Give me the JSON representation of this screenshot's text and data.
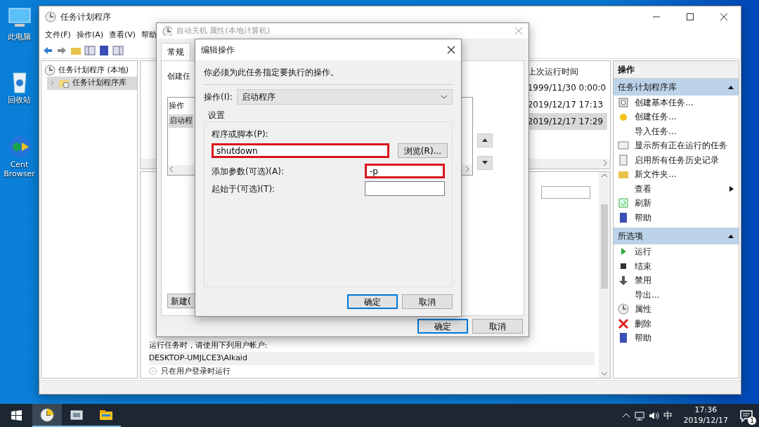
{
  "desktop_icons": [
    {
      "label": "此电脑"
    },
    {
      "label": "回收站"
    },
    {
      "label": "Cent Browser"
    }
  ],
  "main_window": {
    "title": "任务计划程序",
    "menu": [
      "文件(F)",
      "操作(A)",
      "查看(V)",
      "帮助"
    ],
    "tree": [
      {
        "label": "任务计划程序 (本地)",
        "selected": false,
        "children": [
          {
            "label": "任务计划程序库",
            "selected": true,
            "expanded": false
          }
        ]
      }
    ],
    "task_list": {
      "column": "上次运行时间",
      "rows": [
        {
          "cell": "1999/11/30 0:00:0",
          "selected": false
        },
        {
          "cell": "2019/12/17 17:13",
          "selected": false
        },
        {
          "cell": "2019/12/17 17:29",
          "selected": true
        }
      ]
    },
    "details": {
      "account_label": "运行任务时，请使用下列用户帐户:",
      "account": "DESKTOP-UMJLCE3\\Alkaid",
      "radio": {
        "label": "只在用户登录时运行",
        "checked": false
      }
    },
    "actions_pane": {
      "title": "操作",
      "sections": [
        {
          "title": "任务计划程序库",
          "items": [
            {
              "label": "创建基本任务...",
              "submenu": false
            },
            {
              "label": "创建任务...",
              "submenu": false
            },
            {
              "label": "导入任务...",
              "submenu": false
            },
            {
              "label": "显示所有正在运行的任务",
              "submenu": false
            },
            {
              "label": "启用所有任务历史记录",
              "submenu": false
            },
            {
              "label": "新文件夹...",
              "submenu": false
            },
            {
              "label": "查看",
              "submenu": true
            },
            {
              "label": "刷新",
              "submenu": false
            },
            {
              "label": "帮助",
              "submenu": false
            }
          ]
        },
        {
          "title": "所选项",
          "items": [
            {
              "label": "运行",
              "submenu": false
            },
            {
              "label": "结束",
              "submenu": false
            },
            {
              "label": "禁用",
              "submenu": false
            },
            {
              "label": "导出...",
              "submenu": false
            },
            {
              "label": "属性",
              "submenu": false
            },
            {
              "label": "删除",
              "submenu": false
            },
            {
              "label": "帮助",
              "submenu": false
            }
          ]
        }
      ]
    }
  },
  "properties_dialog": {
    "title": "自动关机 属性(本地计算机)",
    "tabs": [
      {
        "label": "常规",
        "selected": true
      }
    ],
    "intro": "创建任",
    "actions_table": {
      "column": "操作",
      "rows": [
        {
          "cell": "启动程",
          "selected": true
        }
      ]
    },
    "new_button": "新建(",
    "buttons": [
      {
        "label": "确定",
        "default": true
      },
      {
        "label": "取消",
        "default": false
      }
    ]
  },
  "edit_dialog": {
    "title": "编辑操作",
    "intro": "你必须为此任务指定要执行的操作。",
    "action_label": "操作(I):",
    "action_value": "启动程序",
    "group_title": "设置",
    "fields": [
      {
        "label": "程序或脚本(P):",
        "value": "shutdown",
        "highlighted": true,
        "kind": "wide"
      },
      {
        "label": "添加参数(可选)(A):",
        "value": "-p",
        "highlighted": true,
        "kind": "inline"
      },
      {
        "label": "起始于(可选)(T):",
        "highlighted": false,
        "kind": "inline"
      }
    ],
    "browse_button": "浏览(R)...",
    "buttons": [
      {
        "label": "确定",
        "default": true
      },
      {
        "label": "取消",
        "default": false
      }
    ]
  },
  "taskbar": {
    "apps": [
      {
        "active": true
      },
      {
        "active": false
      },
      {
        "active": false
      }
    ],
    "ime": "中",
    "time": "17:36",
    "date": "2019/12/17",
    "notification_count": "1"
  }
}
